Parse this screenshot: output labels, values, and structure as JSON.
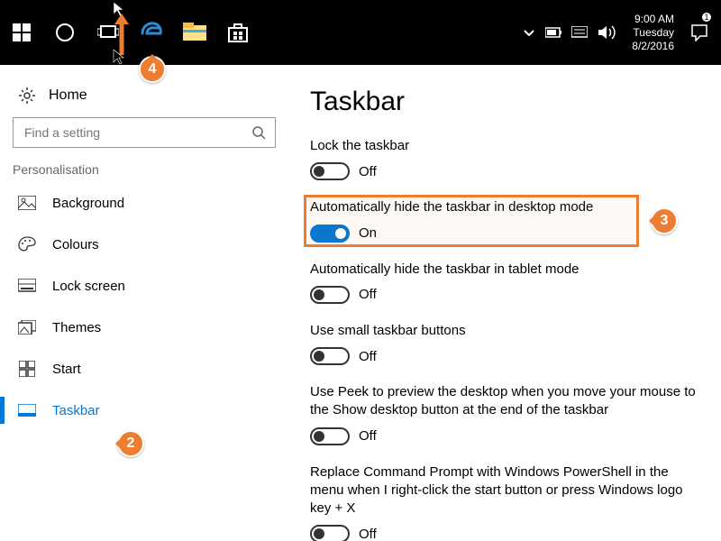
{
  "taskbar": {
    "clock": {
      "time": "9:00 AM",
      "day": "Tuesday",
      "date": "8/2/2016"
    },
    "action_center_count": "1"
  },
  "sidebar": {
    "home": "Home",
    "search_placeholder": "Find a setting",
    "category": "Personalisation",
    "items": [
      {
        "label": "Background"
      },
      {
        "label": "Colours"
      },
      {
        "label": "Lock screen"
      },
      {
        "label": "Themes"
      },
      {
        "label": "Start"
      },
      {
        "label": "Taskbar"
      }
    ]
  },
  "content": {
    "title": "Taskbar",
    "opts": [
      {
        "label": "Lock the taskbar",
        "state": "Off",
        "on": false
      },
      {
        "label": "Automatically hide the taskbar in desktop mode",
        "state": "On",
        "on": true
      },
      {
        "label": "Automatically hide the taskbar in tablet mode",
        "state": "Off",
        "on": false
      },
      {
        "label": "Use small taskbar buttons",
        "state": "Off",
        "on": false
      },
      {
        "label": "Use Peek to preview the desktop when you move your mouse to the Show desktop button at the end of the taskbar",
        "state": "Off",
        "on": false
      },
      {
        "label": "Replace Command Prompt with Windows PowerShell in the menu when I right-click the start button or press Windows logo key + X",
        "state": "Off",
        "on": false
      }
    ]
  },
  "annotations": {
    "c2": "2",
    "c3": "3",
    "c4": "4"
  }
}
